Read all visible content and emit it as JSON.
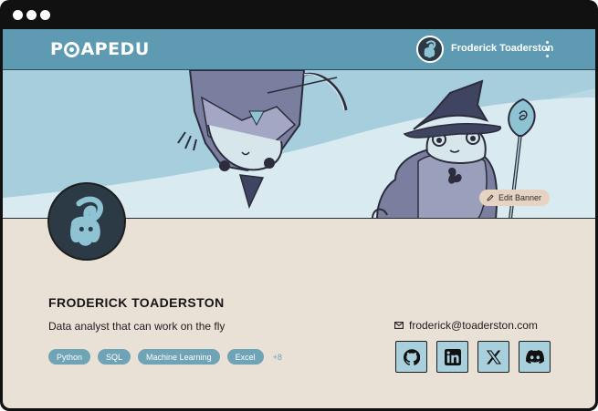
{
  "window": {
    "controls": [
      "dot",
      "dot",
      "dot"
    ]
  },
  "navbar": {
    "logo_text_before": "P",
    "logo_text_after": "APEDU",
    "username": "Froderick Toaderston",
    "menu_icon": "kebab-menu-icon"
  },
  "banner": {
    "edit_label": "Edit Banner"
  },
  "profile": {
    "name": "FRODERICK TOADERSTON",
    "bio": "Data analyst that can work on the fly",
    "email": "froderick@toaderston.com",
    "skills": [
      "Python",
      "SQL",
      "Machine Learning",
      "Excel"
    ],
    "more_skills": "+8"
  },
  "socials": [
    {
      "name": "github",
      "icon": "github-icon"
    },
    {
      "name": "linkedin",
      "icon": "linkedin-icon"
    },
    {
      "name": "x",
      "icon": "x-icon"
    },
    {
      "name": "discord",
      "icon": "discord-icon"
    }
  ],
  "colors": {
    "navbar": "#5e9bb2",
    "banner_sky": "#b7d8e2",
    "page_background": "#e9e0d6",
    "tag": "#6fa3b6",
    "social_button": "#a8d0dc",
    "avatar": "#2b3a45"
  }
}
